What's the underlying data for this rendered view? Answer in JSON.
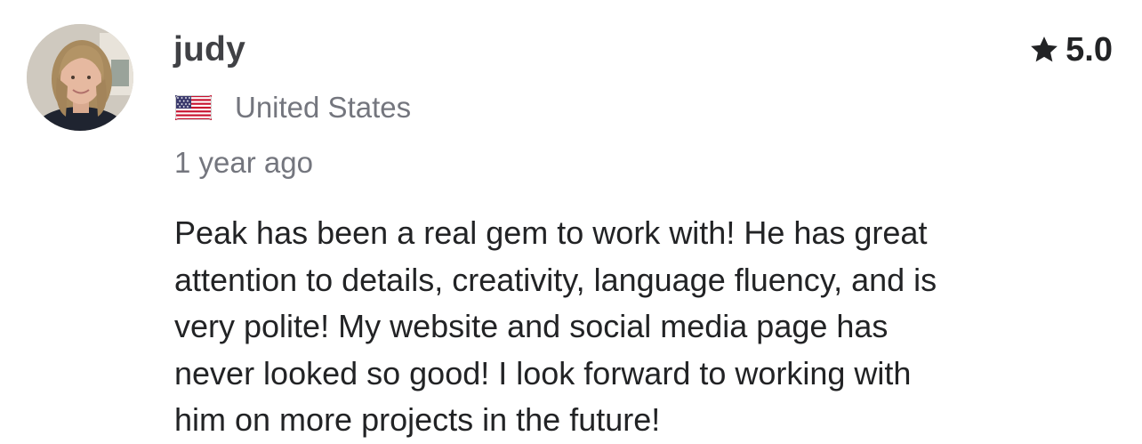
{
  "review": {
    "username": "judy",
    "rating": "5.0",
    "country": "United States",
    "time_ago": "1 year ago",
    "text": "Peak has been a real gem to work with! He has great\nattention to details, creativity, language fluency, and is\nvery polite! My website and social media page has\nnever looked so good! I look forward to working with\nhim on more projects in the future!"
  },
  "icons": {
    "rating": "star-icon",
    "country": "us-flag-icon",
    "avatar": "reviewer-avatar"
  },
  "colors": {
    "primary_text": "#222325",
    "username": "#404145",
    "secondary_text": "#74767e"
  }
}
